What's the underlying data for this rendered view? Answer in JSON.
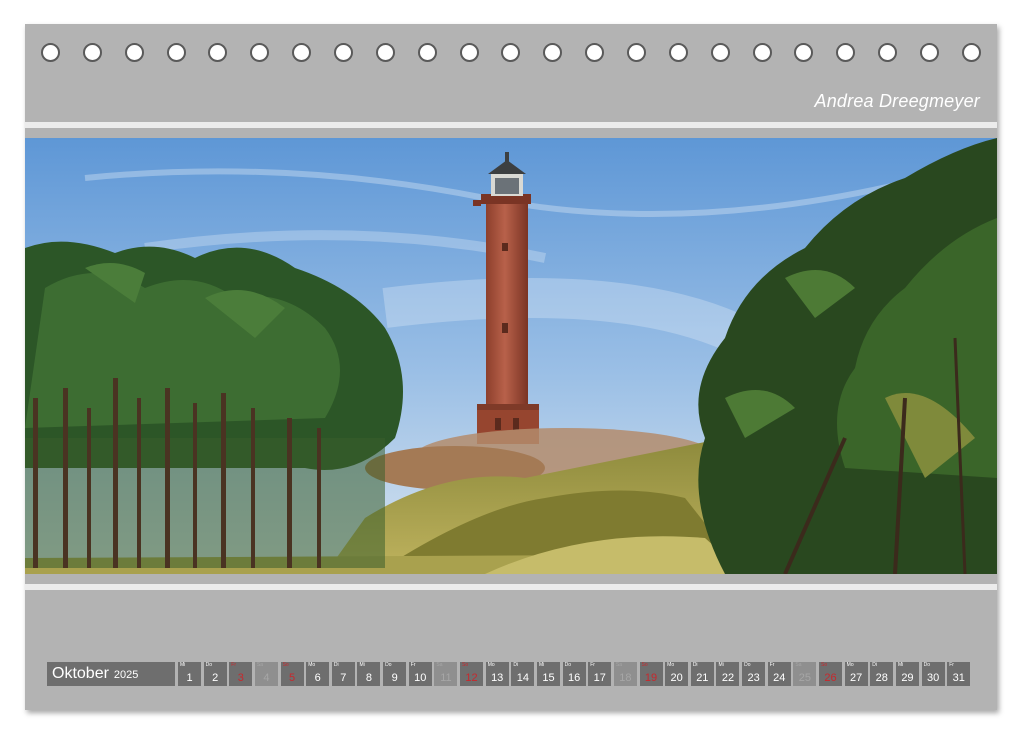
{
  "author": "Andrea Dreegmeyer",
  "month": {
    "name": "Oktober",
    "year": "2025"
  },
  "days": [
    {
      "wd": "Mi",
      "num": "1",
      "type": "weekday"
    },
    {
      "wd": "Do",
      "num": "2",
      "type": "weekday"
    },
    {
      "wd": "Fr",
      "num": "3",
      "type": "sat"
    },
    {
      "wd": "Sa",
      "num": "4",
      "type": "hol"
    },
    {
      "wd": "So",
      "num": "5",
      "type": "sun"
    },
    {
      "wd": "Mo",
      "num": "6",
      "type": "weekday"
    },
    {
      "wd": "Di",
      "num": "7",
      "type": "weekday"
    },
    {
      "wd": "Mi",
      "num": "8",
      "type": "weekday"
    },
    {
      "wd": "Do",
      "num": "9",
      "type": "weekday"
    },
    {
      "wd": "Fr",
      "num": "10",
      "type": "weekday"
    },
    {
      "wd": "Sa",
      "num": "11",
      "type": "hol"
    },
    {
      "wd": "So",
      "num": "12",
      "type": "sun"
    },
    {
      "wd": "Mo",
      "num": "13",
      "type": "weekday"
    },
    {
      "wd": "Di",
      "num": "14",
      "type": "weekday"
    },
    {
      "wd": "Mi",
      "num": "15",
      "type": "weekday"
    },
    {
      "wd": "Do",
      "num": "16",
      "type": "weekday"
    },
    {
      "wd": "Fr",
      "num": "17",
      "type": "weekday"
    },
    {
      "wd": "Sa",
      "num": "18",
      "type": "hol"
    },
    {
      "wd": "So",
      "num": "19",
      "type": "sun"
    },
    {
      "wd": "Mo",
      "num": "20",
      "type": "weekday"
    },
    {
      "wd": "Di",
      "num": "21",
      "type": "weekday"
    },
    {
      "wd": "Mi",
      "num": "22",
      "type": "weekday"
    },
    {
      "wd": "Do",
      "num": "23",
      "type": "weekday"
    },
    {
      "wd": "Fr",
      "num": "24",
      "type": "weekday"
    },
    {
      "wd": "Sa",
      "num": "25",
      "type": "hol"
    },
    {
      "wd": "So",
      "num": "26",
      "type": "sun"
    },
    {
      "wd": "Mo",
      "num": "27",
      "type": "weekday"
    },
    {
      "wd": "Di",
      "num": "28",
      "type": "weekday"
    },
    {
      "wd": "Mi",
      "num": "29",
      "type": "weekday"
    },
    {
      "wd": "Do",
      "num": "30",
      "type": "weekday"
    },
    {
      "wd": "Fr",
      "num": "31",
      "type": "weekday"
    }
  ],
  "colors": {
    "frame": "#b3b3b3",
    "day_cell": "#6e6e6e",
    "sunday_red": "#c8282d",
    "sky": "#8fb7e3",
    "tower_brick": "#b0543c",
    "pine": "#2f5a2a",
    "dune_grass": "#a9a14e"
  },
  "icons": {
    "binding_hole": "ring-hole-icon"
  }
}
